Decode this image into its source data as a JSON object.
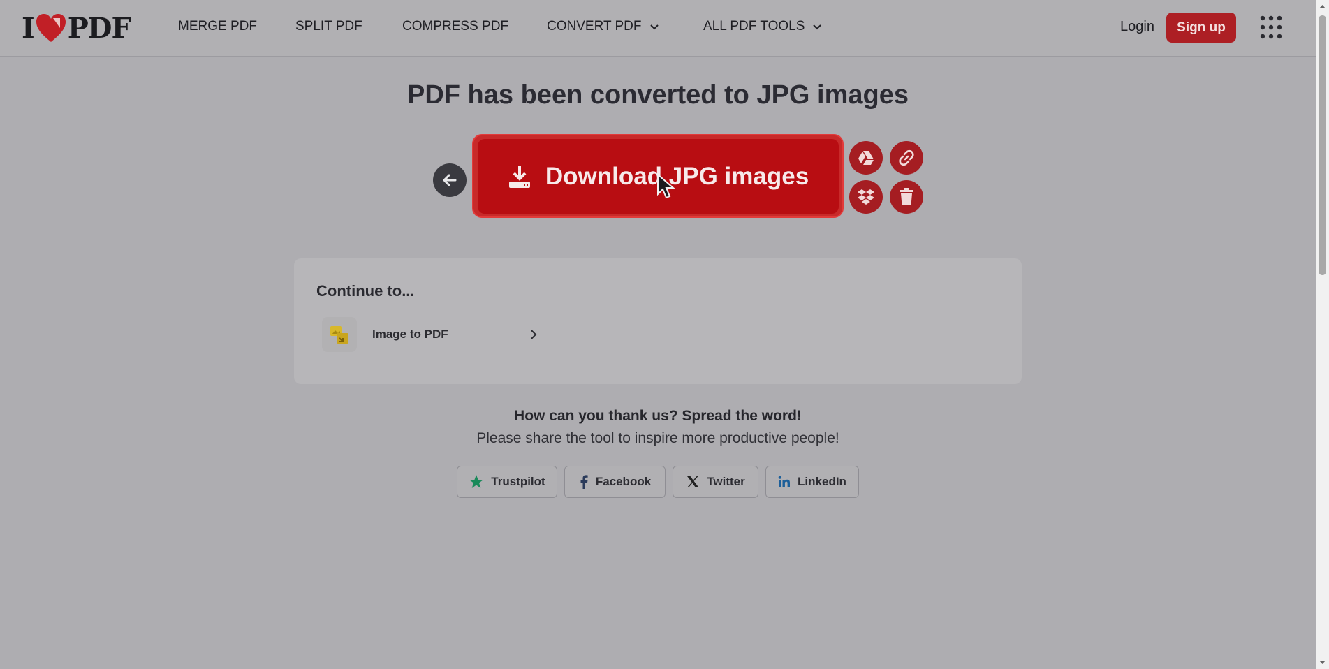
{
  "header": {
    "logo": {
      "left": "I",
      "right": "PDF"
    },
    "nav": [
      {
        "label": "MERGE PDF"
      },
      {
        "label": "SPLIT PDF"
      },
      {
        "label": "COMPRESS PDF"
      },
      {
        "label": "CONVERT PDF"
      },
      {
        "label": "ALL PDF TOOLS"
      }
    ],
    "login_label": "Login",
    "signup_label": "Sign up"
  },
  "main": {
    "title": "PDF has been converted to JPG images",
    "download_label": "Download JPG images",
    "continue": {
      "title": "Continue to...",
      "items": [
        {
          "label": "Image to PDF"
        }
      ]
    },
    "thanks": "How can you thank us? Spread the word!",
    "share_text": "Please share the tool to inspire more productive people!",
    "social": [
      {
        "label": "Trustpilot"
      },
      {
        "label": "Facebook"
      },
      {
        "label": "Twitter"
      },
      {
        "label": "LinkedIn"
      }
    ]
  },
  "colors": {
    "brand_red": "#b80d12",
    "overlay_bg": "#aeadb1",
    "trustpilot_green": "#1a8a5a",
    "linkedin_blue": "#1d5f9a"
  },
  "icons": [
    "heart-logo-icon",
    "chevron-down-icon",
    "apps-grid-icon",
    "arrow-left-icon",
    "download-icon",
    "google-drive-icon",
    "link-icon",
    "dropbox-icon",
    "trash-icon",
    "image-to-pdf-icon",
    "chevron-right-icon",
    "trustpilot-star-icon",
    "facebook-icon",
    "x-twitter-icon",
    "linkedin-icon",
    "mouse-pointer-icon"
  ]
}
